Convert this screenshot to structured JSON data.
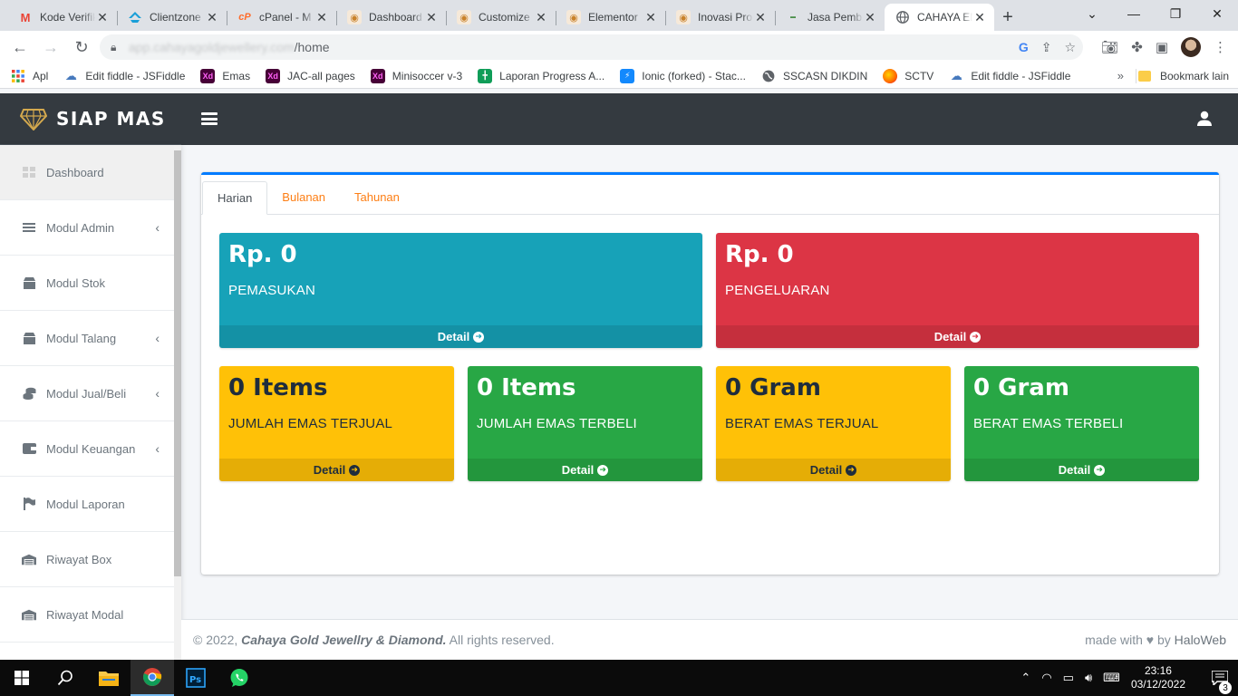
{
  "browser": {
    "tabs": [
      {
        "title": "Kode Verifikasi",
        "favicon": "gmail-icon",
        "active": false
      },
      {
        "title": "Clientzone",
        "favicon": "cloud-icon",
        "active": false
      },
      {
        "title": "cPanel - M",
        "favicon": "cpanel-icon",
        "active": false
      },
      {
        "title": "Dashboard",
        "favicon": "site-icon",
        "active": false
      },
      {
        "title": "Customize",
        "favicon": "site-icon",
        "active": false
      },
      {
        "title": "Elementor",
        "favicon": "site-icon",
        "active": false
      },
      {
        "title": "Inovasi Pro",
        "favicon": "site-icon",
        "active": false
      },
      {
        "title": "Jasa Pemb",
        "favicon": "site-icon",
        "active": false
      },
      {
        "title": "CAHAYA EMAS",
        "favicon": "globe-icon",
        "active": true
      }
    ],
    "url_host": "app.cahayagoldjewellery.com",
    "url_path": "/home",
    "bookmarks": [
      {
        "label": "Apl",
        "icon": "apps-icon"
      },
      {
        "label": "Edit fiddle - JSFiddle",
        "icon": "jsfiddle-icon"
      },
      {
        "label": "Emas",
        "icon": "xd-icon"
      },
      {
        "label": "JAC-all pages",
        "icon": "xd-icon"
      },
      {
        "label": "Minisoccer v-3",
        "icon": "xd-icon"
      },
      {
        "label": "Laporan Progress A...",
        "icon": "sheets-icon"
      },
      {
        "label": "Ionic (forked) - Stac...",
        "icon": "stackblitz-icon"
      },
      {
        "label": "SSCASN DIKDIN",
        "icon": "globe-icon"
      },
      {
        "label": "SCTV",
        "icon": "sctv-icon"
      },
      {
        "label": "Edit fiddle - JSFiddle",
        "icon": "jsfiddle-icon"
      }
    ],
    "bookmarks_more": "»",
    "other_bookmarks": "Bookmark lain"
  },
  "app": {
    "brand": "SIAP MAS",
    "sidebar": [
      {
        "label": "Dashboard",
        "icon": "dashboard-icon",
        "active": true,
        "has_children": false
      },
      {
        "label": "Modul Admin",
        "icon": "list-icon",
        "active": false,
        "has_children": true
      },
      {
        "label": "Modul Stok",
        "icon": "box-icon",
        "active": false,
        "has_children": false
      },
      {
        "label": "Modul Talang",
        "icon": "box-icon",
        "active": false,
        "has_children": true
      },
      {
        "label": "Modul Jual/Beli",
        "icon": "coins-icon",
        "active": false,
        "has_children": true
      },
      {
        "label": "Modul Keuangan",
        "icon": "wallet-icon",
        "active": false,
        "has_children": true
      },
      {
        "label": "Modul Laporan",
        "icon": "flag-icon",
        "active": false,
        "has_children": false
      },
      {
        "label": "Riwayat Box",
        "icon": "warehouse-icon",
        "active": false,
        "has_children": false
      },
      {
        "label": "Riwayat Modal",
        "icon": "warehouse-icon",
        "active": false,
        "has_children": false
      }
    ],
    "tabs": [
      {
        "label": "Harian",
        "active": true
      },
      {
        "label": "Bulanan",
        "active": false
      },
      {
        "label": "Tahunan",
        "active": false
      }
    ],
    "stats": [
      {
        "value": "Rp. 0",
        "label": "PEMASUKAN",
        "link": "Detail",
        "color": "#17a2b8"
      },
      {
        "value": "Rp. 0",
        "label": "PENGELUARAN",
        "link": "Detail",
        "color": "#dc3545"
      },
      {
        "value": "0 Items",
        "label": "JUMLAH EMAS TERJUAL",
        "link": "Detail",
        "color": "#ffc107"
      },
      {
        "value": "0 Items",
        "label": "JUMLAH EMAS TERBELI",
        "link": "Detail",
        "color": "#28a745"
      },
      {
        "value": "0 Gram",
        "label": "BERAT EMAS TERJUAL",
        "link": "Detail",
        "color": "#ffc107"
      },
      {
        "value": "0 Gram",
        "label": "BERAT EMAS TERBELI",
        "link": "Detail",
        "color": "#28a745"
      }
    ],
    "footer": {
      "copyright_prefix": "© 2022, ",
      "company": "Cahaya Gold Jewellry & Diamond.",
      "rights": " All rights reserved.",
      "made_with": "made with ♥ by ",
      "author": "HaloWeb"
    }
  },
  "taskbar": {
    "time": "23:16",
    "date": "03/12/2022",
    "notifications": "3"
  }
}
